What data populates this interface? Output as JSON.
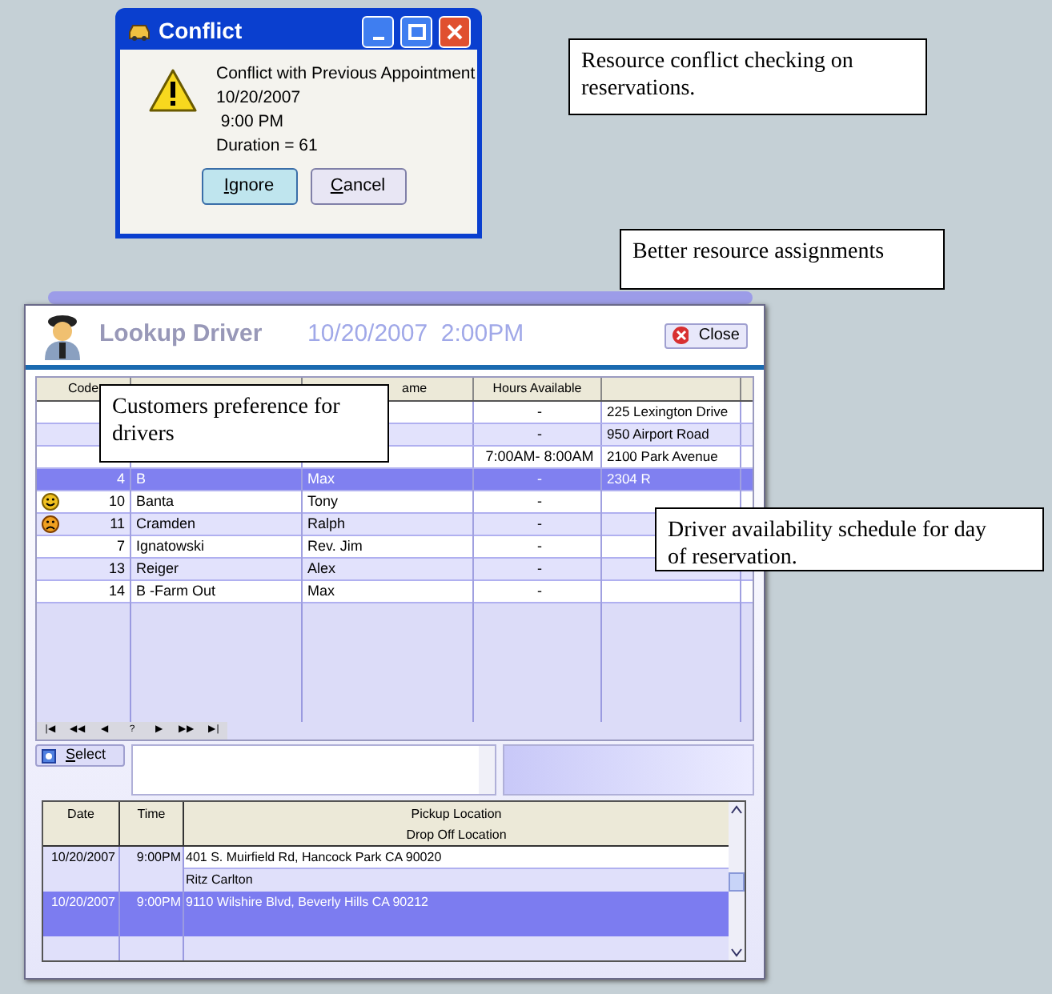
{
  "dialog": {
    "title": "Conflict",
    "message_lines": [
      "Conflict with Previous Appointment",
      "10/20/2007",
      " 9:00 PM",
      "Duration = 61"
    ],
    "buttons": [
      {
        "label": "Ignore",
        "default": true
      },
      {
        "label": "Cancel",
        "default": false
      }
    ]
  },
  "callouts": [
    "Resource conflict checking on reservations.",
    "Better resource assignments",
    "Customers preference for drivers",
    "Driver availability schedule for day of reservation."
  ],
  "lookup": {
    "title": "Lookup Driver",
    "datetime": "10/20/2007  2:00PM",
    "close_label": "Close",
    "columns": [
      "Code",
      "",
      "ame",
      "Hours Available",
      ""
    ],
    "rows": [
      {
        "kind": "plain",
        "hours": "-",
        "address": "225 Lexington Drive",
        "selected": false
      },
      {
        "kind": "plain",
        "hours": "-",
        "address": "950 Airport Road",
        "selected": false
      },
      {
        "kind": "plain",
        "hours": "7:00AM- 8:00AM",
        "address": "2100 Park Avenue",
        "selected": false
      },
      {
        "kind": "plain",
        "code": "4",
        "last": "B",
        "first": "Max",
        "hours": "-",
        "address": "2304 R",
        "selected": true
      },
      {
        "kind": "liked",
        "code": "10",
        "last": "Banta",
        "first": "Tony",
        "hours": "-",
        "selected": false
      },
      {
        "kind": "disliked",
        "code": "11",
        "last": "Cramden",
        "first": "Ralph",
        "hours": "-",
        "selected": false
      },
      {
        "kind": "plain",
        "code": "7",
        "last": "Ignatowski",
        "first": "Rev. Jim",
        "hours": "-",
        "selected": false
      },
      {
        "kind": "plain",
        "code": "13",
        "last": "Reiger",
        "first": "Alex",
        "hours": "-",
        "selected": false
      },
      {
        "kind": "plain",
        "code": "14",
        "last": "B -Farm Out",
        "first": "Max",
        "hours": "-",
        "selected": false
      }
    ],
    "nav_buttons": [
      "|◀",
      "◀◀",
      "◀",
      "?",
      "▶",
      "▶▶",
      "▶|"
    ],
    "select_label": "Select",
    "trips": {
      "columns": [
        "Date",
        "Time",
        "Pickup Location",
        "Drop Off Location"
      ],
      "rows": [
        {
          "date": "10/20/2007",
          "time": "9:00PM",
          "pickup": "401 S. Muirfield Rd, Hancock Park CA 90020",
          "dropoff": "Ritz Carlton",
          "selected": false
        },
        {
          "date": "10/20/2007",
          "time": "9:00PM",
          "pickup": "9110 Wilshire Blvd, Beverly Hills CA 90212",
          "selected": true
        }
      ]
    }
  }
}
